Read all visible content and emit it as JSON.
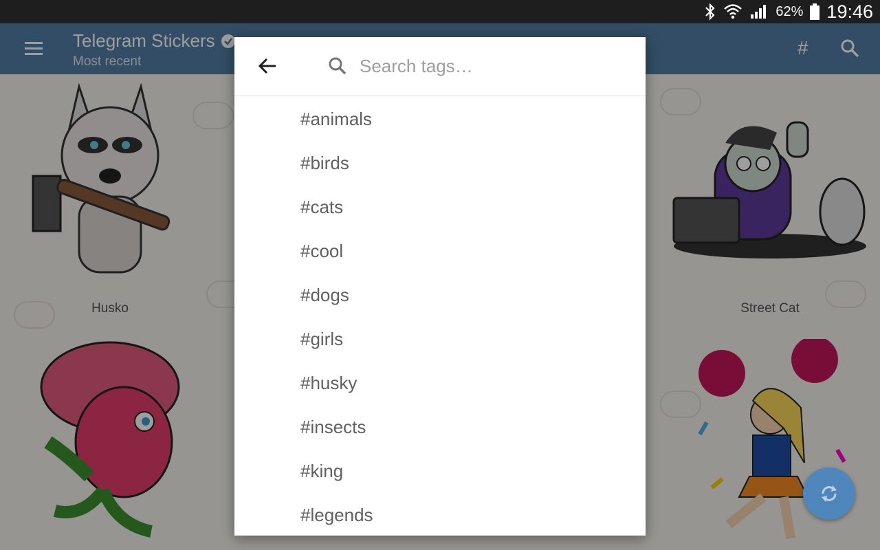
{
  "status_bar": {
    "battery_percent": "62%",
    "time": "19:46",
    "icons": [
      "bluetooth-icon",
      "wifi-icon",
      "signal-icon",
      "battery-icon"
    ]
  },
  "app_bar": {
    "title": "Telegram Stickers",
    "subtitle": "Most recent",
    "icons": [
      "menu-icon",
      "verified-icon",
      "hash-icon",
      "search-icon"
    ]
  },
  "stickers": [
    {
      "name": "Husko"
    },
    {
      "name": "Street Cat"
    }
  ],
  "dialog": {
    "search_placeholder": "Search tags…",
    "tags": [
      "#animals",
      "#birds",
      "#cats",
      "#cool",
      "#dogs",
      "#girls",
      "#husky",
      "#insects",
      "#king",
      "#legends"
    ]
  },
  "colors": {
    "app_bar": "#527da3",
    "fab": "#4f86bb",
    "status_bar": "#1e1e1e"
  }
}
